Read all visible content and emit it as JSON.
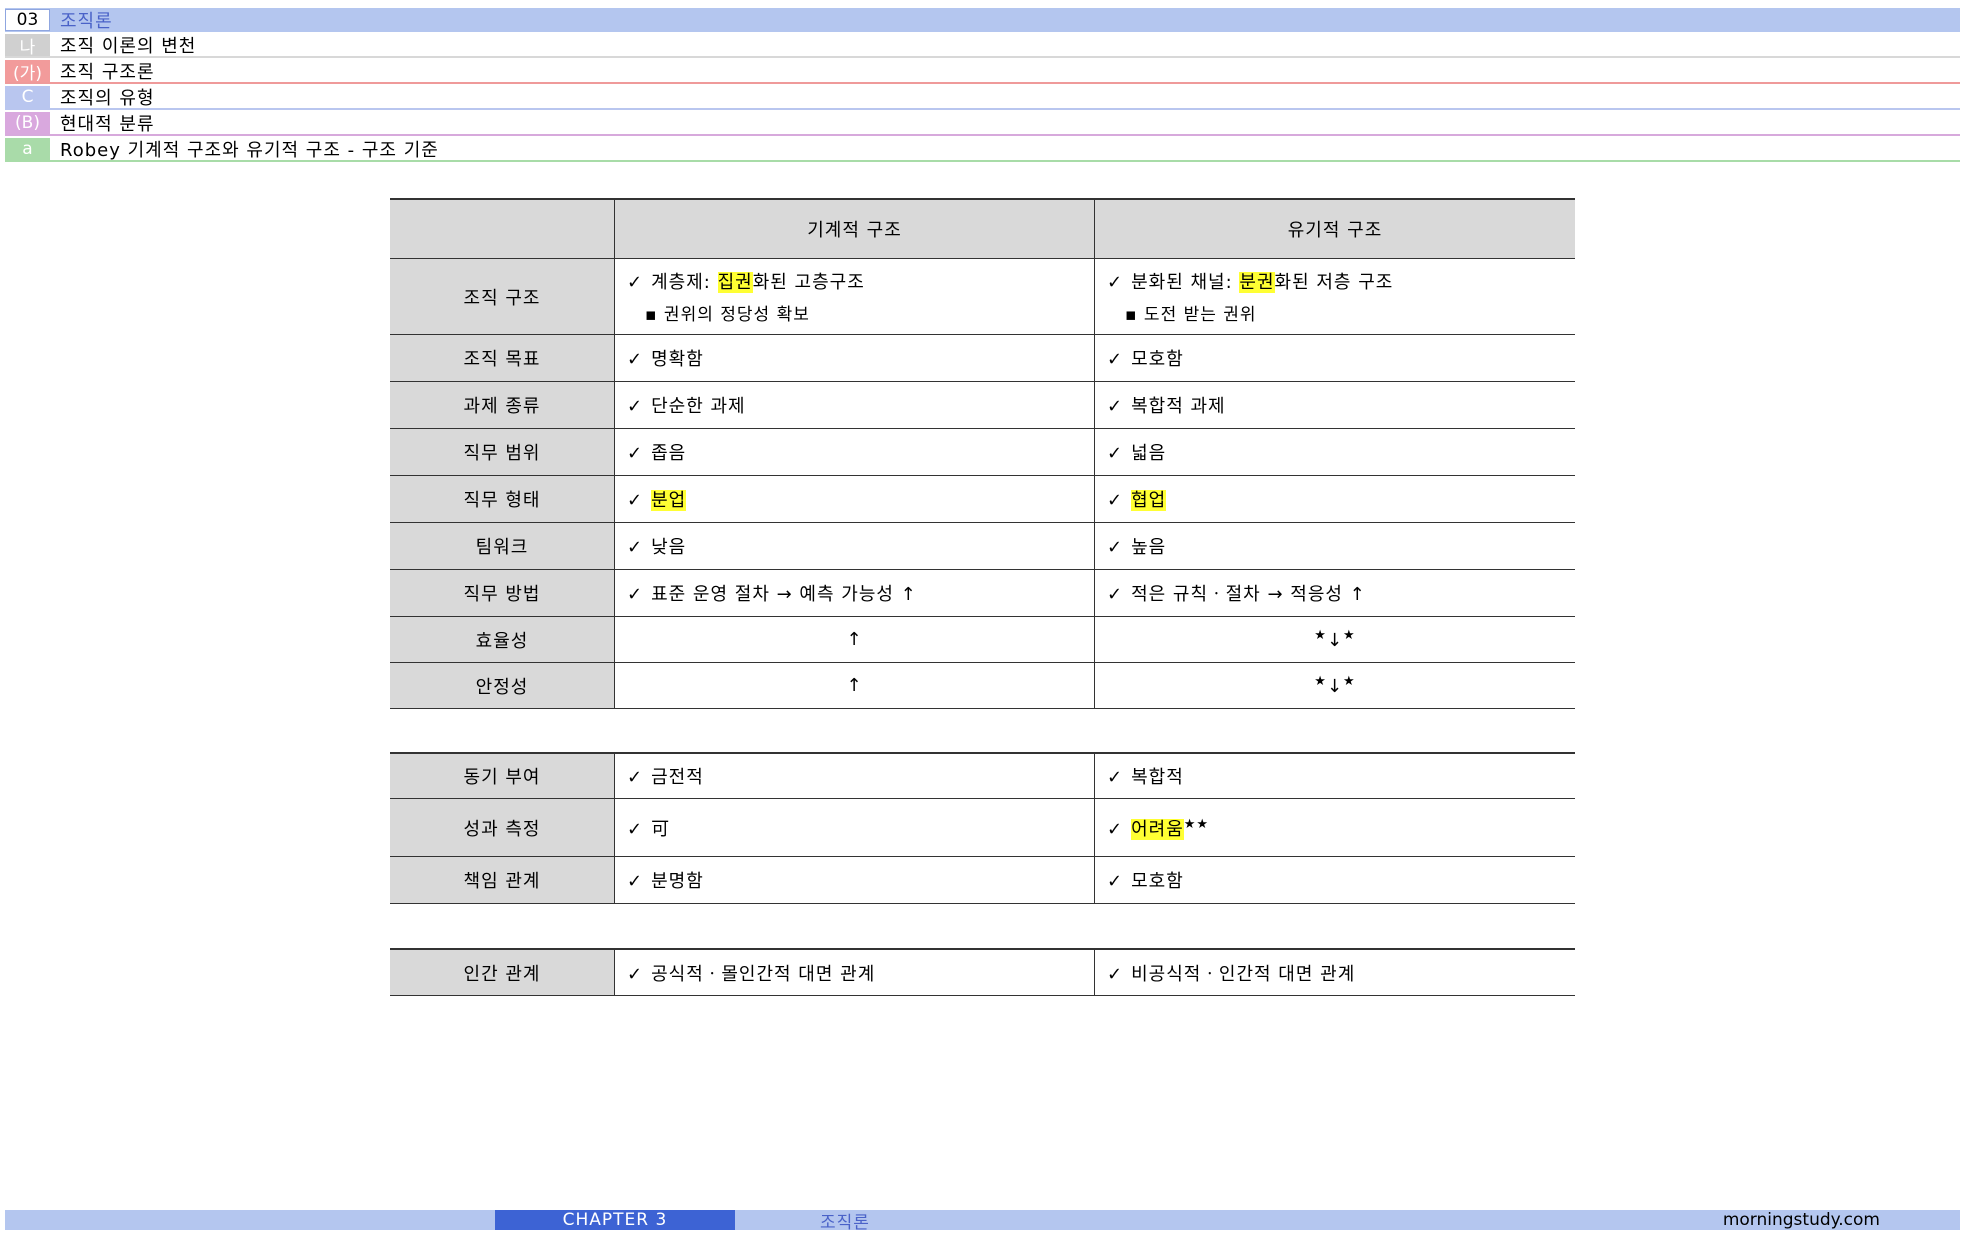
{
  "header": {
    "chapter_num": "03",
    "chapter_title": "조직론",
    "lines": [
      {
        "num": "나",
        "text": "조직 이론의 변천"
      },
      {
        "num": "(가)",
        "text": "조직 구조론"
      },
      {
        "num": "C",
        "text": "조직의 유형"
      },
      {
        "num": "(B)",
        "text": "현대적 분류"
      },
      {
        "num": "a",
        "text": "Robey 기계적 구조와 유기적 구조 - 구조 기준"
      }
    ]
  },
  "table": {
    "col1_header": "기계적 구조",
    "col2_header": "유기적 구조",
    "check": "✓",
    "rows": {
      "org_structure": {
        "label": "조직 구조",
        "c1_pre": "계층제: ",
        "c1_hl": "집권",
        "c1_post": "화된 고층구조",
        "c1_sub": "▪ 권위의 정당성 확보",
        "c2_pre": "분화된 채널: ",
        "c2_hl": "분권",
        "c2_post": "화된 저층 구조",
        "c2_sub": "▪ 도전 받는 권위"
      },
      "org_goal": {
        "label": "조직 목표",
        "c1": "명확함",
        "c2": "모호함"
      },
      "task_type": {
        "label": "과제 종류",
        "c1": "단순한 과제",
        "c2": "복합적 과제"
      },
      "job_scope": {
        "label": "직무 범위",
        "c1": "좁음",
        "c2": "넓음"
      },
      "job_form": {
        "label": "직무 형태",
        "c1_hl": "분업",
        "c2_hl": "협업"
      },
      "teamwork": {
        "label": "팀워크",
        "c1": "낮음",
        "c2": "높음"
      },
      "job_method": {
        "label": "직무 방법",
        "c1": "표준 운영 절차 → 예측 가능성 ↑",
        "c2": "적은 규칙ㆍ절차 → 적응성 ↑"
      },
      "efficiency": {
        "label": "효율성",
        "c1": "↑",
        "c2_star": "★",
        "c2_arrow": "↓"
      },
      "stability": {
        "label": "안정성",
        "c1": "↑",
        "c2_star": "★",
        "c2_arrow": "↓"
      },
      "motivation": {
        "label": "동기 부여",
        "c1": "금전적",
        "c2": "복합적"
      },
      "performance": {
        "label": "성과 측정",
        "c1": "可",
        "c2_hl": "어려움",
        "c2_stars": "★★"
      },
      "responsibility": {
        "label": "책임 관계",
        "c1": "분명함",
        "c2": "모호함"
      },
      "human_relations": {
        "label": "인간 관계",
        "c1": "공식적ㆍ몰인간적 대면 관계",
        "c2": "비공식적ㆍ인간적 대면 관계"
      }
    }
  },
  "footer": {
    "chapter": "CHAPTER 3",
    "title": "조직론",
    "site": "morningstudy.com"
  }
}
